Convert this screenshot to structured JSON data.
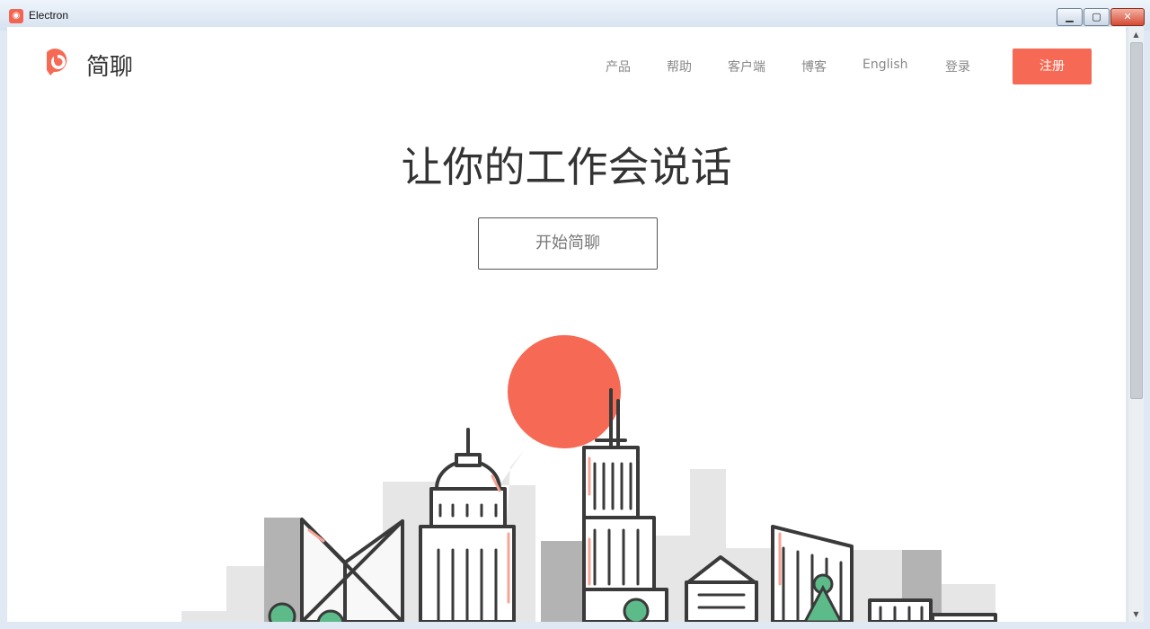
{
  "window": {
    "title": "Electron",
    "icon": "app-logo-icon",
    "buttons": [
      "minimize-icon",
      "maximize-icon",
      "close-icon"
    ]
  },
  "header": {
    "brand": "简聊",
    "logo_icon": "jianliao-logo-icon",
    "nav": [
      "产品",
      "帮助",
      "客户端",
      "博客",
      "English",
      "登录"
    ],
    "signup": "注册"
  },
  "hero": {
    "title": "让你的工作会说话",
    "cta": "开始简聊"
  },
  "colors": {
    "accent": "#f66955",
    "text": "#333333",
    "nav_text": "#888888"
  }
}
